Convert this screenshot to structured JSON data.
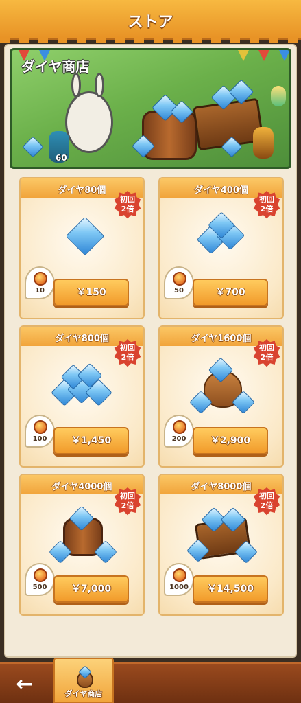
{
  "header": {
    "title": "ストア"
  },
  "banner": {
    "title": "ダイヤ商店",
    "level": "60"
  },
  "products": [
    {
      "title": "ダイヤ80個",
      "badge_line1": "初回",
      "badge_line2": "2倍",
      "bonus": "10",
      "price": "￥150"
    },
    {
      "title": "ダイヤ400個",
      "badge_line1": "初回",
      "badge_line2": "2倍",
      "bonus": "50",
      "price": "￥700"
    },
    {
      "title": "ダイヤ800個",
      "badge_line1": "初回",
      "badge_line2": "2倍",
      "bonus": "100",
      "price": "￥1,450"
    },
    {
      "title": "ダイヤ1600個",
      "badge_line1": "初回",
      "badge_line2": "2倍",
      "bonus": "200",
      "price": "￥2,900"
    },
    {
      "title": "ダイヤ4000個",
      "badge_line1": "初回",
      "badge_line2": "2倍",
      "bonus": "500",
      "price": "￥7,000"
    },
    {
      "title": "ダイヤ8000個",
      "badge_line1": "初回",
      "badge_line2": "2倍",
      "bonus": "1000",
      "price": "￥14,500"
    }
  ],
  "bottom_nav": {
    "back_icon": "←",
    "tab_label": "ダイヤ商店"
  }
}
